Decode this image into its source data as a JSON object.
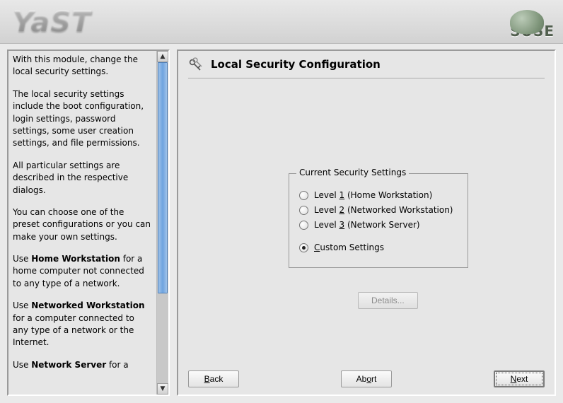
{
  "brand": {
    "product": "YaST",
    "vendor": "SUSE"
  },
  "help": {
    "p1": "With this module, change the local security settings.",
    "p2": "The local security settings include the boot configuration, login settings, password settings, some user creation settings, and file permissions.",
    "p3": "All particular settings are described in the respective dialogs.",
    "p4": "You can choose one of the preset configurations or you can make your own settings.",
    "p5_pre": "Use ",
    "p5_bold": "Home Workstation",
    "p5_post": " for a home computer not connected to any type of a network.",
    "p6_pre": "Use ",
    "p6_bold": "Networked Workstation",
    "p6_post": " for a computer connected to any type of a network or the Internet.",
    "p7_pre": "Use ",
    "p7_bold": "Network Server",
    "p7_post": " for a"
  },
  "page": {
    "title": "Local Security Configuration",
    "group_legend": "Current Security Settings",
    "radios": {
      "level1_pre": "Level ",
      "level1_key": "1",
      "level1_post": " (Home Workstation)",
      "level2_pre": "Level ",
      "level2_key": "2",
      "level2_post": " (Networked Workstation)",
      "level3_pre": "Level ",
      "level3_key": "3",
      "level3_post": " (Network Server)",
      "custom_key": "C",
      "custom_post": "ustom Settings"
    },
    "selected": "custom",
    "details_label": "Details..."
  },
  "buttons": {
    "back_key": "B",
    "back_post": "ack",
    "abort_pre": "Ab",
    "abort_key": "o",
    "abort_post": "rt",
    "next_key": "N",
    "next_post": "ext"
  }
}
